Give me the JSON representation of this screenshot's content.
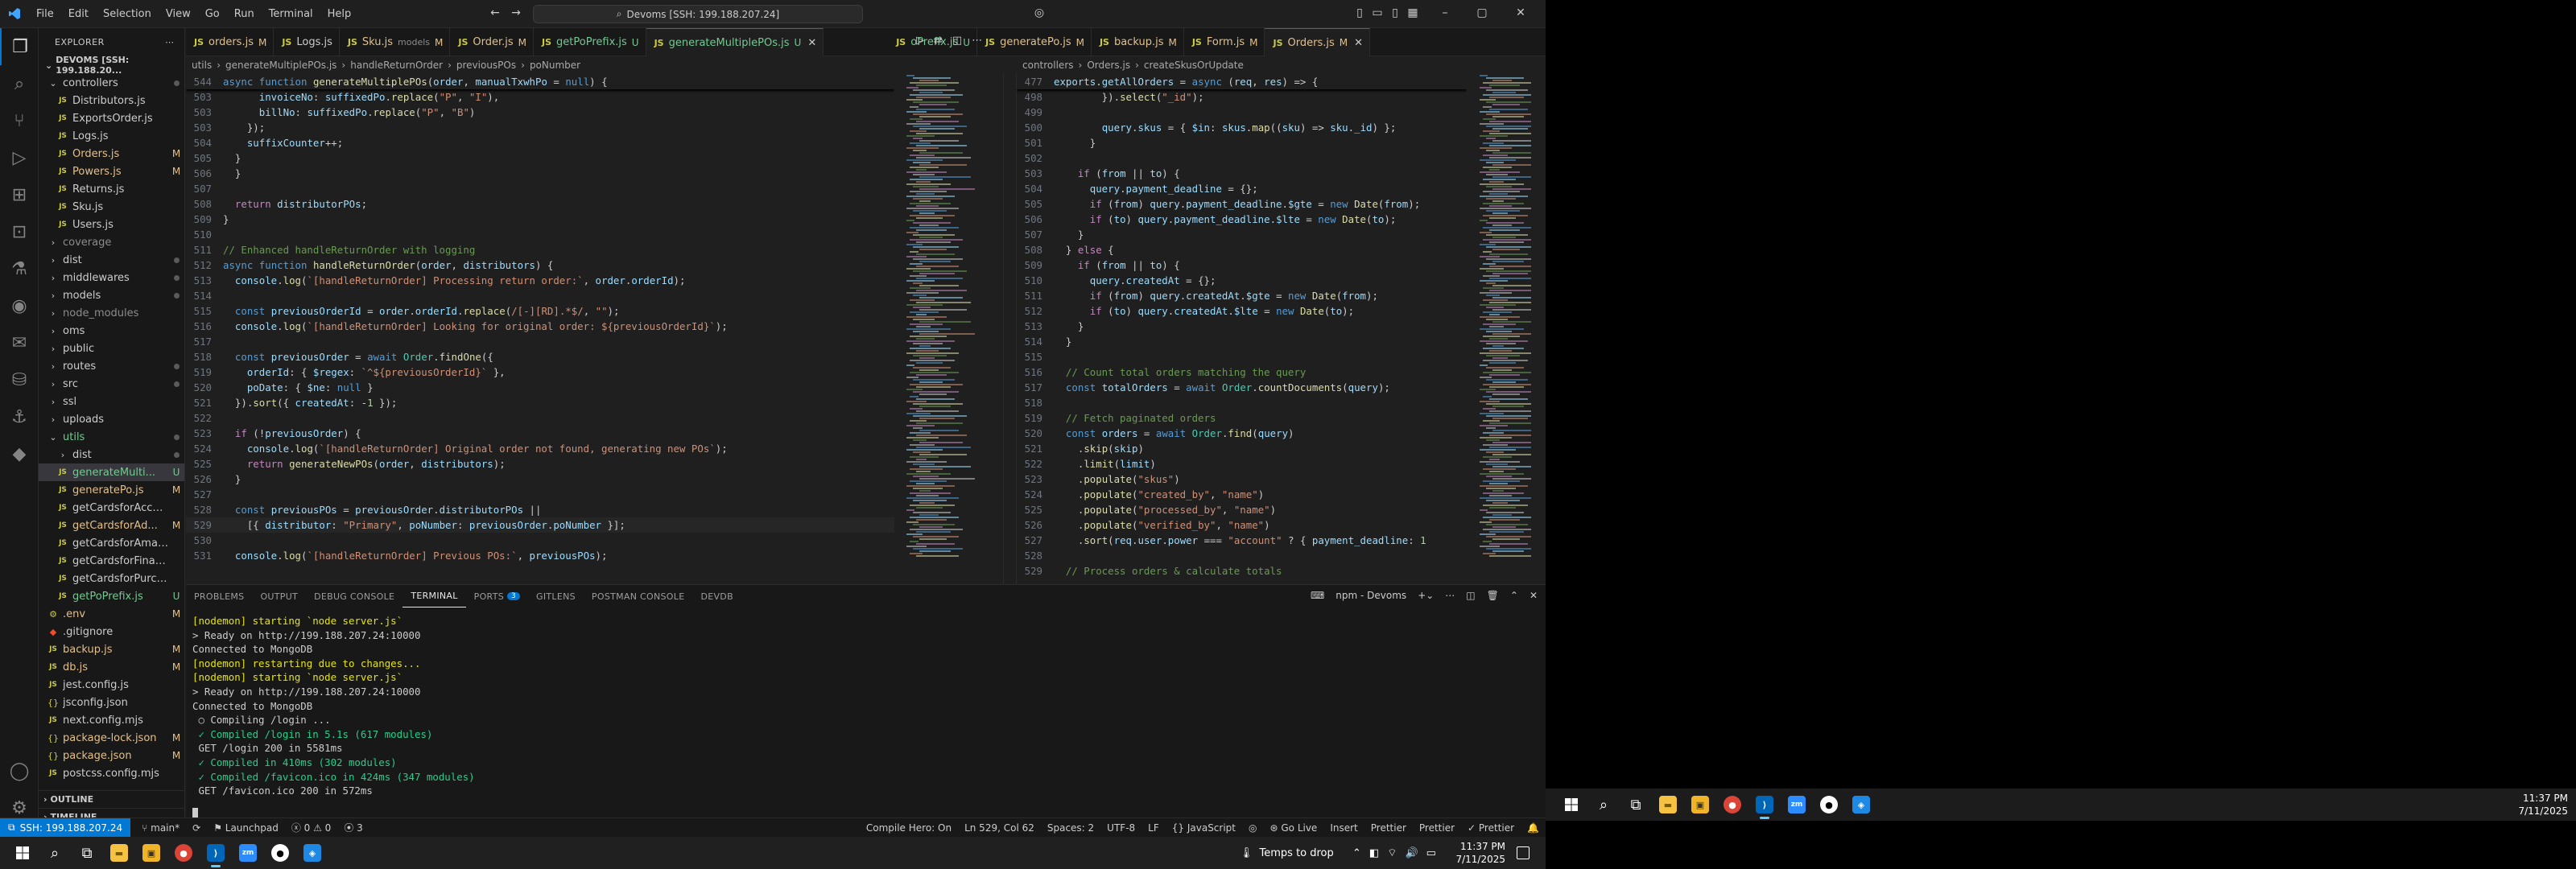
{
  "title_bar": {
    "menu": [
      "File",
      "Edit",
      "Selection",
      "View",
      "Go",
      "Run",
      "Terminal",
      "Help"
    ],
    "search_text": "Devoms [SSH: 199.188.207.24]"
  },
  "explorer": {
    "header": "EXPLORER",
    "root": "DEVOMS [SSH: 199.188.20...",
    "items": [
      {
        "name": "controllers",
        "type": "folder",
        "open": true,
        "indent": 0,
        "status": "dot"
      },
      {
        "name": "Distributors.js",
        "type": "js",
        "indent": 1,
        "status": ""
      },
      {
        "name": "ExportsOrder.js",
        "type": "js",
        "indent": 1,
        "status": ""
      },
      {
        "name": "Logs.js",
        "type": "js",
        "indent": 1,
        "status": ""
      },
      {
        "name": "Orders.js",
        "type": "js",
        "indent": 1,
        "status": "M",
        "color": "#e2c08d"
      },
      {
        "name": "Powers.js",
        "type": "js",
        "indent": 1,
        "status": "M",
        "color": "#e2c08d"
      },
      {
        "name": "Returns.js",
        "type": "js",
        "indent": 1,
        "status": ""
      },
      {
        "name": "Sku.js",
        "type": "js",
        "indent": 1,
        "status": ""
      },
      {
        "name": "Users.js",
        "type": "js",
        "indent": 1,
        "status": ""
      },
      {
        "name": "coverage",
        "type": "folder",
        "indent": 0,
        "status": "",
        "color": "#8c8c8c"
      },
      {
        "name": "dist",
        "type": "folder",
        "indent": 0,
        "status": "dot"
      },
      {
        "name": "middlewares",
        "type": "folder",
        "indent": 0,
        "status": "dot"
      },
      {
        "name": "models",
        "type": "folder",
        "indent": 0,
        "status": "dot"
      },
      {
        "name": "node_modules",
        "type": "folder",
        "indent": 0,
        "status": "",
        "color": "#8c8c8c"
      },
      {
        "name": "oms",
        "type": "folder",
        "indent": 0,
        "status": ""
      },
      {
        "name": "public",
        "type": "folder",
        "indent": 0,
        "status": ""
      },
      {
        "name": "routes",
        "type": "folder",
        "indent": 0,
        "status": "dot"
      },
      {
        "name": "src",
        "type": "folder",
        "indent": 0,
        "status": "dot"
      },
      {
        "name": "ssl",
        "type": "folder",
        "indent": 0,
        "status": ""
      },
      {
        "name": "uploads",
        "type": "folder",
        "indent": 0,
        "status": ""
      },
      {
        "name": "utils",
        "type": "folder",
        "open": true,
        "indent": 0,
        "status": "dot",
        "color": "#73c991"
      },
      {
        "name": "dist",
        "type": "folder",
        "indent": 1,
        "status": "dot"
      },
      {
        "name": "generateMulti...",
        "type": "js",
        "indent": 1,
        "status": "U",
        "color": "#73c991",
        "selected": true
      },
      {
        "name": "generatePo.js",
        "type": "js",
        "indent": 1,
        "status": "M",
        "color": "#e2c08d"
      },
      {
        "name": "getCardsforAccount.js",
        "type": "js",
        "indent": 1,
        "status": ""
      },
      {
        "name": "getCardsforAd...",
        "type": "js",
        "indent": 1,
        "status": "M",
        "color": "#e2c08d"
      },
      {
        "name": "getCardsforAmazon.js",
        "type": "js",
        "indent": 1,
        "status": ""
      },
      {
        "name": "getCardsforFinance.js",
        "type": "js",
        "indent": 1,
        "status": ""
      },
      {
        "name": "getCardsforPurchasi...",
        "type": "js",
        "indent": 1,
        "status": ""
      },
      {
        "name": "getPoPrefix.js",
        "type": "js",
        "indent": 1,
        "status": "U",
        "color": "#73c991"
      },
      {
        "name": ".env",
        "type": "env",
        "indent": 0,
        "status": "M",
        "color": "#e2c08d"
      },
      {
        "name": ".gitignore",
        "type": "git",
        "indent": 0,
        "status": ""
      },
      {
        "name": "backup.js",
        "type": "js",
        "indent": 0,
        "status": "M",
        "color": "#e2c08d"
      },
      {
        "name": "db.js",
        "type": "js",
        "indent": 0,
        "status": "M",
        "color": "#e2c08d"
      },
      {
        "name": "jest.config.js",
        "type": "js",
        "indent": 0,
        "status": ""
      },
      {
        "name": "jsconfig.json",
        "type": "json",
        "indent": 0,
        "status": ""
      },
      {
        "name": "next.config.mjs",
        "type": "js",
        "indent": 0,
        "status": ""
      },
      {
        "name": "package-lock.json",
        "type": "json",
        "indent": 0,
        "status": "M",
        "color": "#e2c08d"
      },
      {
        "name": "package.json",
        "type": "json",
        "indent": 0,
        "status": "M",
        "color": "#e2c08d"
      },
      {
        "name": "postcss.config.mjs",
        "type": "js",
        "indent": 0,
        "status": ""
      }
    ],
    "outline": "OUTLINE",
    "timeline": "TIMELINE"
  },
  "tabs": [
    {
      "name": "orders.js",
      "mark": "M",
      "status": "#e2c08d"
    },
    {
      "name": "Logs.js",
      "mark": "",
      "status": "#cccccc"
    },
    {
      "name": "Sku.js",
      "extra": "models",
      "mark": "M",
      "status": "#e2c08d"
    },
    {
      "name": "Order.js",
      "mark": "M",
      "status": "#e2c08d"
    },
    {
      "name": "getPoPrefix.js",
      "mark": "U",
      "status": "#73c991"
    },
    {
      "name": "generateMultiplePOs.js",
      "mark": "U",
      "status": "#73c991",
      "active": true
    },
    {
      "name": "oPrefix.js",
      "mark": "U",
      "status": "#73c991"
    },
    {
      "name": "generatePo.js",
      "mark": "M",
      "status": "#e2c08d"
    },
    {
      "name": "backup.js",
      "mark": "M",
      "status": "#e2c08d"
    },
    {
      "name": "Form.js",
      "mark": "M",
      "status": "#e2c08d"
    },
    {
      "name": "Orders.js",
      "mark": "M",
      "status": "#e2c08d",
      "active": true
    }
  ],
  "left_editor": {
    "breadcrumb": [
      "utils",
      "generateMultiplePOs.js",
      "handleReturnOrder",
      "previousPOs",
      "poNumber"
    ],
    "sticky_num": "544",
    "sticky": "async function generateMultiplePOs(order, manualTxwhPo = null) {",
    "lines": [
      [
        "503",
        "      invoiceNo: suffixedPo.replace(\"P\", \"I\"),"
      ],
      [
        "503",
        "      billNo: suffixedPo.replace(\"P\", \"B\")"
      ],
      [
        "503",
        "    });"
      ],
      [
        "504",
        "    suffixCounter++;"
      ],
      [
        "505",
        "  }"
      ],
      [
        "506",
        "  }"
      ],
      [
        "507",
        ""
      ],
      [
        "508",
        "  return distributorPOs;"
      ],
      [
        "509",
        "}"
      ],
      [
        "510",
        ""
      ],
      [
        "511",
        "// Enhanced handleReturnOrder with logging"
      ],
      [
        "512",
        "async function handleReturnOrder(order, distributors) {"
      ],
      [
        "513",
        "  console.log(`[handleReturnOrder] Processing return order:`, order.orderId);"
      ],
      [
        "514",
        ""
      ],
      [
        "515",
        "  const previousOrderId = order.orderId.replace(/[-][RD].*$/, \"\");"
      ],
      [
        "516",
        "  console.log(`[handleReturnOrder] Looking for original order: ${previousOrderId}`);"
      ],
      [
        "517",
        ""
      ],
      [
        "518",
        "  const previousOrder = await Order.findOne({"
      ],
      [
        "519",
        "    orderId: { $regex: `^${previousOrderId}` },"
      ],
      [
        "520",
        "    poDate: { $ne: null }"
      ],
      [
        "521",
        "  }).sort({ createdAt: -1 });"
      ],
      [
        "522",
        ""
      ],
      [
        "523",
        "  if (!previousOrder) {"
      ],
      [
        "524",
        "    console.log(`[handleReturnOrder] Original order not found, generating new POs`);"
      ],
      [
        "525",
        "    return generateNewPOs(order, distributors);"
      ],
      [
        "526",
        "  }"
      ],
      [
        "527",
        ""
      ],
      [
        "528",
        "  const previousPOs = previousOrder.distributorPOs ||"
      ],
      [
        "529",
        "    [{ distributor: \"Primary\", poNumber: previousOrder.poNumber }];"
      ],
      [
        "530",
        ""
      ],
      [
        "531",
        "  console.log(`[handleReturnOrder] Previous POs:`, previousPOs);"
      ]
    ]
  },
  "right_editor": {
    "breadcrumb": [
      "controllers",
      "Orders.js",
      "createSkusOrUpdate"
    ],
    "sticky_num": "477",
    "sticky": "exports.getAllOrders = async (req, res) => {",
    "lines": [
      [
        "498",
        "        }).select(\"_id\");"
      ],
      [
        "499",
        ""
      ],
      [
        "500",
        "        query.skus = { $in: skus.map((sku) => sku._id) };"
      ],
      [
        "501",
        "      }"
      ],
      [
        "502",
        ""
      ],
      [
        "503",
        "    if (from || to) {"
      ],
      [
        "504",
        "      query.payment_deadline = {};"
      ],
      [
        "505",
        "      if (from) query.payment_deadline.$gte = new Date(from);"
      ],
      [
        "506",
        "      if (to) query.payment_deadline.$lte = new Date(to);"
      ],
      [
        "507",
        "    }"
      ],
      [
        "508",
        "  } else {"
      ],
      [
        "509",
        "    if (from || to) {"
      ],
      [
        "510",
        "      query.createdAt = {};"
      ],
      [
        "511",
        "      if (from) query.createdAt.$gte = new Date(from);"
      ],
      [
        "512",
        "      if (to) query.createdAt.$lte = new Date(to);"
      ],
      [
        "513",
        "    }"
      ],
      [
        "514",
        "  }"
      ],
      [
        "515",
        ""
      ],
      [
        "516",
        "  // Count total orders matching the query"
      ],
      [
        "517",
        "  const totalOrders = await Order.countDocuments(query);"
      ],
      [
        "518",
        ""
      ],
      [
        "519",
        "  // Fetch paginated orders"
      ],
      [
        "520",
        "  const orders = await Order.find(query)"
      ],
      [
        "521",
        "    .skip(skip)"
      ],
      [
        "522",
        "    .limit(limit)"
      ],
      [
        "523",
        "    .populate(\"skus\")"
      ],
      [
        "524",
        "    .populate(\"created_by\", \"name\")"
      ],
      [
        "525",
        "    .populate(\"processed_by\", \"name\")"
      ],
      [
        "526",
        "    .populate(\"verified_by\", \"name\")"
      ],
      [
        "527",
        "    .sort(req.user.power === \"account\" ? { payment_deadline: 1"
      ],
      [
        "528",
        ""
      ],
      [
        "529",
        "  // Process orders & calculate totals"
      ]
    ]
  },
  "panel": {
    "tabs": [
      "PROBLEMS",
      "OUTPUT",
      "DEBUG CONSOLE",
      "TERMINAL",
      "PORTS",
      "GITLENS",
      "POSTMAN CONSOLE",
      "DEVDB"
    ],
    "ports_badge": "3",
    "terminal_name": "npm - Devoms",
    "lines": [
      {
        "t": "[nodemon] starting `node server.js`",
        "c": "ty"
      },
      {
        "t": "> Ready on http://199.188.207.24:10000",
        "c": ""
      },
      {
        "t": "Connected to MongoDB",
        "c": ""
      },
      {
        "t": "[nodemon] restarting due to changes...",
        "c": "ty"
      },
      {
        "t": "[nodemon] starting `node server.js`",
        "c": "ty"
      },
      {
        "t": "> Ready on http://199.188.207.24:10000",
        "c": ""
      },
      {
        "t": "Connected to MongoDB",
        "c": ""
      },
      {
        "t": " ○ Compiling /login ...",
        "c": ""
      },
      {
        "t": " ✓ Compiled /login in 5.1s (617 modules)",
        "c": "tg"
      },
      {
        "t": " GET /login 200 in 5581ms",
        "c": ""
      },
      {
        "t": " ✓ Compiled in 410ms (302 modules)",
        "c": "tg"
      },
      {
        "t": " ✓ Compiled /favicon.ico in 424ms (347 modules)",
        "c": "tg"
      },
      {
        "t": " GET /favicon.ico 200 in 572ms",
        "c": ""
      }
    ]
  },
  "status_bar": {
    "remote": "SSH: 199.188.207.24",
    "branch": "main*",
    "errors": "0",
    "warnings": "0",
    "ports": "3",
    "launchpad": "Launchpad",
    "compile": "Compile Hero: On",
    "position": "Ln 529, Col 62",
    "spaces": "Spaces: 2",
    "encoding": "UTF-8",
    "eol": "LF",
    "language": "JavaScript",
    "golive": "Go Live",
    "insert": "Insert",
    "prettier1": "Prettier",
    "prettier2": "Prettier",
    "prettier3": "Prettier"
  },
  "taskbar_left": {
    "drop_text": "Temps to drop",
    "time": "11:37 PM",
    "date": "7/11/2025"
  },
  "taskbar_right": {
    "time": "11:37 PM",
    "date": "7/11/2025"
  }
}
